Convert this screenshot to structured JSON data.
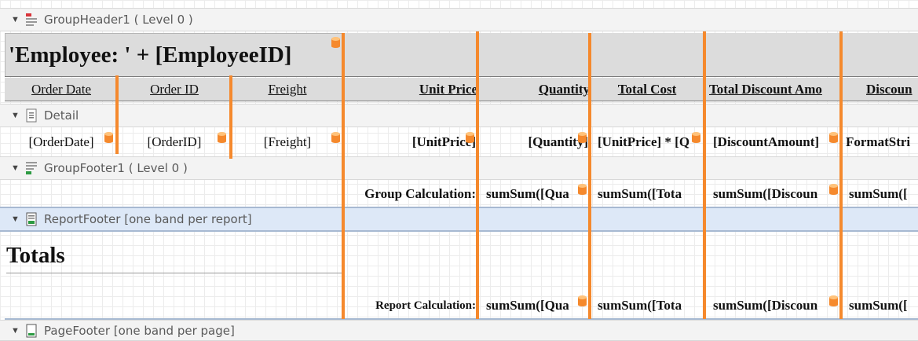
{
  "bands": {
    "group_header": "GroupHeader1 ( Level 0 )",
    "detail": "Detail",
    "group_footer": "GroupFooter1 ( Level 0 )",
    "report_footer": "ReportFooter [one band per report]",
    "page_footer": "PageFooter [one band per page]"
  },
  "group_header": {
    "title_expr": "'Employee: ' + [EmployeeID]",
    "columns": [
      "Order Date",
      "Order ID",
      "Freight",
      "Unit Price",
      "Quantity",
      "Total Cost",
      "Total Discount Amo",
      "Discoun"
    ]
  },
  "detail": {
    "fields": [
      "[OrderDate]",
      "[OrderID]",
      "[Freight]",
      "[UnitPrice]",
      "[Quantity]",
      "[UnitPrice] * [Q",
      "[DiscountAmount]",
      "FormatStri"
    ]
  },
  "group_footer": {
    "label": "Group Calculation:",
    "sums": [
      "sumSum([Qua",
      "sumSum([Tota",
      "sumSum([Discoun",
      "sumSum(["
    ]
  },
  "report_footer": {
    "title": "Totals",
    "label": "Report Calculation:",
    "sums": [
      "sumSum([Qua",
      "sumSum([Tota",
      "sumSum([Discoun",
      "sumSum(["
    ]
  },
  "colors": {
    "resize_handle": "#f5892d",
    "band_header": "#f3f3f3",
    "report_footer_band": "#dde8f7",
    "header_fill": "#dcdcdc"
  }
}
